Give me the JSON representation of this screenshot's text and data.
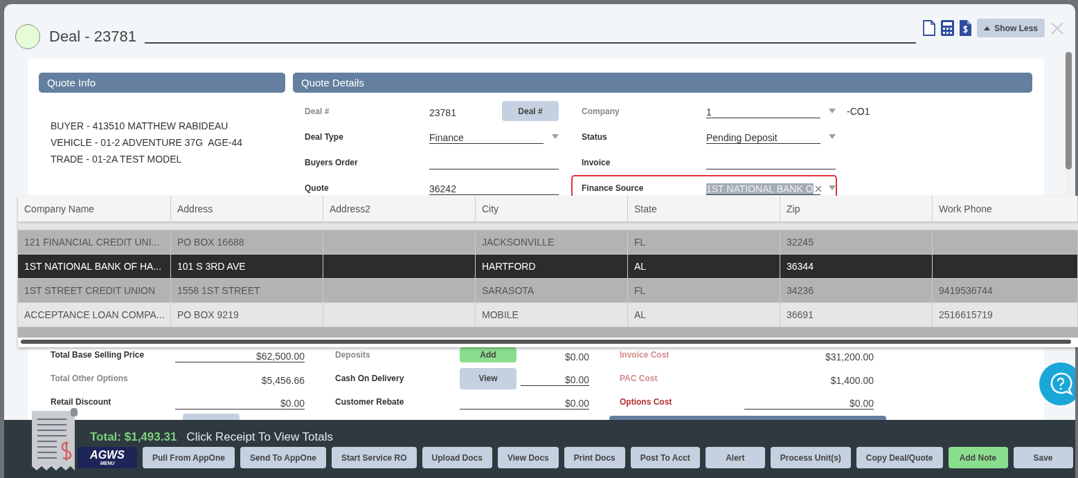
{
  "dialog": {
    "title": "Deal - 23781",
    "show_less": "Show Less"
  },
  "quote_info": {
    "title": "Quote Info",
    "lines": [
      "BUYER - 413510 MATTHEW RABIDEAU",
      "VEHICLE - 01-2 ADVENTURE 37G  AGE-44",
      "TRADE - 01-2A TEST MODEL"
    ]
  },
  "quote_details": {
    "title": "Quote Details",
    "left": [
      {
        "label": "Deal #",
        "muted": true,
        "kind": "plain",
        "value": "23781",
        "button": "Deal #",
        "focused": false
      },
      {
        "label": "Deal Type",
        "muted": false,
        "kind": "dropdown",
        "value": "Finance",
        "focused": false
      },
      {
        "label": "Buyers Order",
        "muted": false,
        "kind": "input",
        "focused": false
      },
      {
        "label": "Quote",
        "muted": false,
        "kind": "input",
        "value": "36242",
        "focused": false
      }
    ],
    "right": [
      {
        "label": "Company",
        "muted": true,
        "kind": "dropdown",
        "value": "1",
        "suffix": "-CO1",
        "focused": false
      },
      {
        "label": "Status",
        "muted": false,
        "kind": "dropdown",
        "value": "Pending Deposit",
        "focused": false
      },
      {
        "label": "Invoice",
        "muted": false,
        "kind": "input",
        "focused": false
      },
      {
        "label": "Finance Source",
        "muted": false,
        "kind": "dropdown",
        "value": "1ST NATIONAL BANK O",
        "focused": true
      }
    ]
  },
  "lookup_grid": {
    "columns": [
      "Company Name",
      "Address",
      "Address2",
      "City",
      "State",
      "Zip",
      "Work Phone"
    ],
    "rows": [
      {
        "cells": [
          "121 FINANCIAL CREDIT UNI...",
          "PO BOX 16688",
          null,
          "JACKSONVILLE",
          "FL",
          "32245",
          null
        ],
        "selected": false
      },
      {
        "cells": [
          "1ST NATIONAL BANK OF HA...",
          "101 S 3RD AVE",
          null,
          "HARTFORD",
          "AL",
          "36344",
          null
        ],
        "selected": true
      },
      {
        "cells": [
          "1ST STREET CREDIT UNION",
          "1558 1ST STREET",
          null,
          "SARASOTA",
          "FL",
          "34236",
          "9419536744"
        ],
        "selected": false
      },
      {
        "cells": [
          "ACCEPTANCE LOAN COMPA...",
          "PO BOX 9219",
          null,
          "MOBILE",
          "AL",
          "36691",
          "2516615719"
        ],
        "selected": false
      }
    ]
  },
  "totals": {
    "groups": [
      {
        "cost": false,
        "items": [
          {
            "label": "Total Base Selling Price",
            "muted": false,
            "kind": "input",
            "value": "$62,500.00"
          },
          {
            "label": "Total Other Options",
            "muted": true,
            "kind": "plain",
            "value": "$5,456.66"
          },
          {
            "label": "Retail Discount",
            "muted": false,
            "kind": "input",
            "value": "$0.00"
          }
        ]
      },
      {
        "cost": false,
        "items": [
          {
            "label": "Deposits",
            "muted": true,
            "kind": "plain",
            "value": "$0.00",
            "button": {
              "label": "Add",
              "kind": "success"
            }
          },
          {
            "label": "Cash On Delivery",
            "muted": false,
            "kind": "input",
            "value": "$0.00",
            "button": {
              "label": "View",
              "kind": "default"
            }
          },
          {
            "label": "Customer Rebate",
            "muted": false,
            "kind": "input",
            "value": "$0.00"
          }
        ]
      },
      {
        "cost": true,
        "items": [
          {
            "label": "Invoice Cost",
            "muted": true,
            "kind": "plain",
            "value": "$31,200.00"
          },
          {
            "label": "PAC Cost",
            "muted": true,
            "kind": "plain",
            "value": "$1,400.00"
          },
          {
            "label": "Options Cost",
            "muted": false,
            "kind": "input",
            "value": "$0.00"
          }
        ]
      }
    ]
  },
  "footer": {
    "total": "Total: $1,493.31",
    "hint": "Click Receipt To View Totals",
    "logo": {
      "text": "AGWS",
      "subtext": "MENU"
    },
    "buttons": [
      {
        "label": "Pull From AppOne",
        "kind": "default"
      },
      {
        "label": "Send To AppOne",
        "kind": "default"
      },
      {
        "label": "Start Service RO",
        "kind": "default"
      },
      {
        "label": "Upload Docs",
        "kind": "default"
      },
      {
        "label": "View Docs",
        "kind": "default"
      },
      {
        "label": "Print Docs",
        "kind": "default"
      },
      {
        "label": "Post To Acct",
        "kind": "default"
      },
      {
        "label": "Alert",
        "kind": "default"
      },
      {
        "label": "Process Unit(s)",
        "kind": "default"
      },
      {
        "label": "Copy Deal/Quote",
        "kind": "default"
      },
      {
        "label": "Add Note",
        "kind": "success"
      },
      {
        "label": "Save",
        "kind": "default"
      }
    ]
  }
}
